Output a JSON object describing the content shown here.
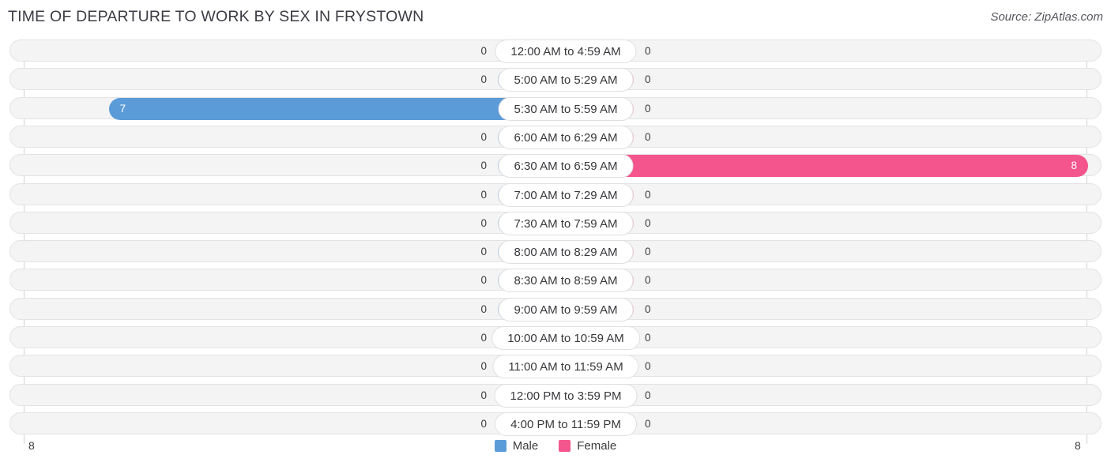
{
  "header": {
    "title": "TIME OF DEPARTURE TO WORK BY SEX IN FRYSTOWN",
    "source": "Source: ZipAtlas.com"
  },
  "legend": {
    "male_label": "Male",
    "female_label": "Female",
    "male_color": "#5b9bd8",
    "female_color": "#f4558c"
  },
  "axis": {
    "left_extreme": "8",
    "right_extreme": "8"
  },
  "colors": {
    "male_strong": "#5b9bd8",
    "male_light": "#aac9ec",
    "female_strong": "#f4558c",
    "female_light": "#f7a9c5",
    "row_track": "#f4f4f4",
    "row_border": "#e3e3e3"
  },
  "chart_data": {
    "type": "bar",
    "orientation": "horizontal-diverging",
    "title": "TIME OF DEPARTURE TO WORK BY SEX IN FRYSTOWN",
    "xlabel": "",
    "ylabel": "",
    "xlim": [
      8,
      8
    ],
    "grid": false,
    "legend_position": "bottom-center",
    "categories": [
      "12:00 AM to 4:59 AM",
      "5:00 AM to 5:29 AM",
      "5:30 AM to 5:59 AM",
      "6:00 AM to 6:29 AM",
      "6:30 AM to 6:59 AM",
      "7:00 AM to 7:29 AM",
      "7:30 AM to 7:59 AM",
      "8:00 AM to 8:29 AM",
      "8:30 AM to 8:59 AM",
      "9:00 AM to 9:59 AM",
      "10:00 AM to 10:59 AM",
      "11:00 AM to 11:59 AM",
      "12:00 PM to 3:59 PM",
      "4:00 PM to 11:59 PM"
    ],
    "series": [
      {
        "name": "Male",
        "values": [
          0,
          0,
          7,
          0,
          0,
          0,
          0,
          0,
          0,
          0,
          0,
          0,
          0,
          0
        ]
      },
      {
        "name": "Female",
        "values": [
          0,
          0,
          0,
          0,
          8,
          0,
          0,
          0,
          0,
          0,
          0,
          0,
          0,
          0
        ]
      }
    ]
  },
  "rows": [
    {
      "label": "12:00 AM to 4:59 AM",
      "male": "0",
      "female": "0"
    },
    {
      "label": "5:00 AM to 5:29 AM",
      "male": "0",
      "female": "0"
    },
    {
      "label": "5:30 AM to 5:59 AM",
      "male": "7",
      "female": "0"
    },
    {
      "label": "6:00 AM to 6:29 AM",
      "male": "0",
      "female": "0"
    },
    {
      "label": "6:30 AM to 6:59 AM",
      "male": "0",
      "female": "8"
    },
    {
      "label": "7:00 AM to 7:29 AM",
      "male": "0",
      "female": "0"
    },
    {
      "label": "7:30 AM to 7:59 AM",
      "male": "0",
      "female": "0"
    },
    {
      "label": "8:00 AM to 8:29 AM",
      "male": "0",
      "female": "0"
    },
    {
      "label": "8:30 AM to 8:59 AM",
      "male": "0",
      "female": "0"
    },
    {
      "label": "9:00 AM to 9:59 AM",
      "male": "0",
      "female": "0"
    },
    {
      "label": "10:00 AM to 10:59 AM",
      "male": "0",
      "female": "0"
    },
    {
      "label": "11:00 AM to 11:59 AM",
      "male": "0",
      "female": "0"
    },
    {
      "label": "12:00 PM to 3:59 PM",
      "male": "0",
      "female": "0"
    },
    {
      "label": "4:00 PM to 11:59 PM",
      "male": "0",
      "female": "0"
    }
  ]
}
